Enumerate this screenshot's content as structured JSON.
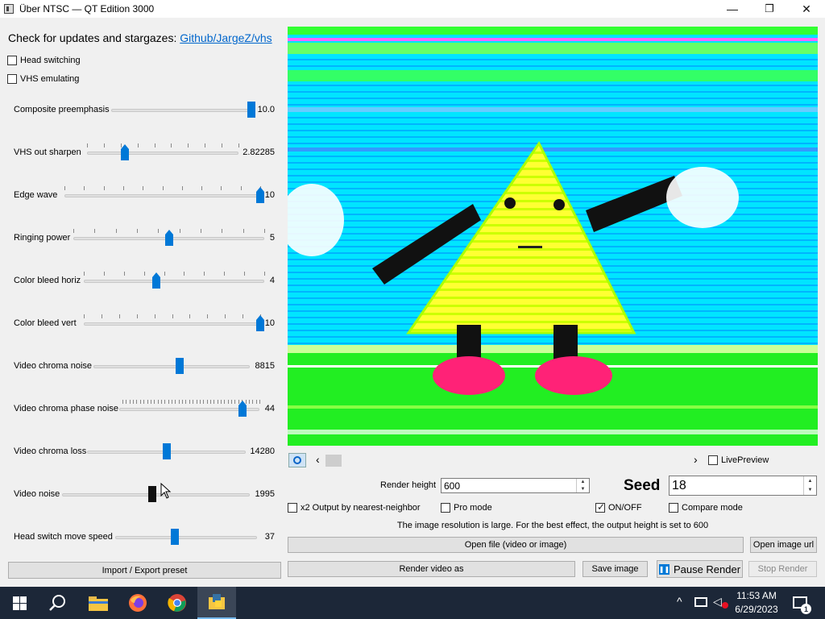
{
  "window": {
    "title": "Über NTSC — QT Edition 3000",
    "minimize_glyph": "—",
    "maximize_glyph": "❐",
    "close_glyph": "✕"
  },
  "left": {
    "updates_text": "Check for updates and stargazes:",
    "updates_link": "Github/JargeZ/vhs",
    "head_switching": {
      "label": "Head switching",
      "checked": false
    },
    "vhs_emulating": {
      "label": "VHS emulating",
      "checked": false
    },
    "sliders": [
      {
        "label": "Composite preemphasis",
        "value": "10.0",
        "position": 1.0
      },
      {
        "label": "VHS out sharpen",
        "value": "2.82285",
        "position": 0.25
      },
      {
        "label": "Edge wave",
        "value": "10",
        "position": 1.0
      },
      {
        "label": "Ringing power",
        "value": "5",
        "position": 0.5
      },
      {
        "label": "Color bleed horiz",
        "value": "4",
        "position": 0.4
      },
      {
        "label": "Color bleed vert",
        "value": "10",
        "position": 1.0
      },
      {
        "label": "Video chroma noise",
        "value": "8815",
        "position": 0.55
      },
      {
        "label": "Video chroma phase noise",
        "value": "44",
        "position": 0.88
      },
      {
        "label": "Video chroma loss",
        "value": "14280",
        "position": 0.5
      },
      {
        "label": "Video noise",
        "value": "1995",
        "position": 0.48
      },
      {
        "label": "Head switch move speed",
        "value": "37",
        "position": 0.42
      }
    ],
    "import_export_label": "Import / Export preset"
  },
  "preview": {
    "live_preview_label": "LivePreview",
    "scroll_left_glyph": "‹",
    "scroll_right_glyph": "›"
  },
  "controls": {
    "render_height_label": "Render height",
    "render_height_value": "600",
    "seed_label": "Seed",
    "seed_value": "18",
    "x2_output_label": "x2 Output by nearest-neighbor",
    "pro_mode_label": "Pro mode",
    "onoff_label": "ON/OFF",
    "compare_mode_label": "Compare mode",
    "info_text": "The image resolution is large. For the best effect, the output height is set to 600",
    "open_file_label": "Open file (video or image)",
    "open_image_url_label": "Open image url",
    "render_video_label": "Render video as",
    "save_image_label": "Save image",
    "pause_render_label": "Pause Render",
    "stop_render_label": "Stop Render"
  },
  "taskbar": {
    "time": "11:53 AM",
    "date": "6/29/2023",
    "notification_count": "1",
    "icons": [
      "windows-start-icon",
      "search-icon",
      "file-explorer-icon",
      "firefox-icon",
      "chrome-icon",
      "python-app-icon"
    ]
  }
}
